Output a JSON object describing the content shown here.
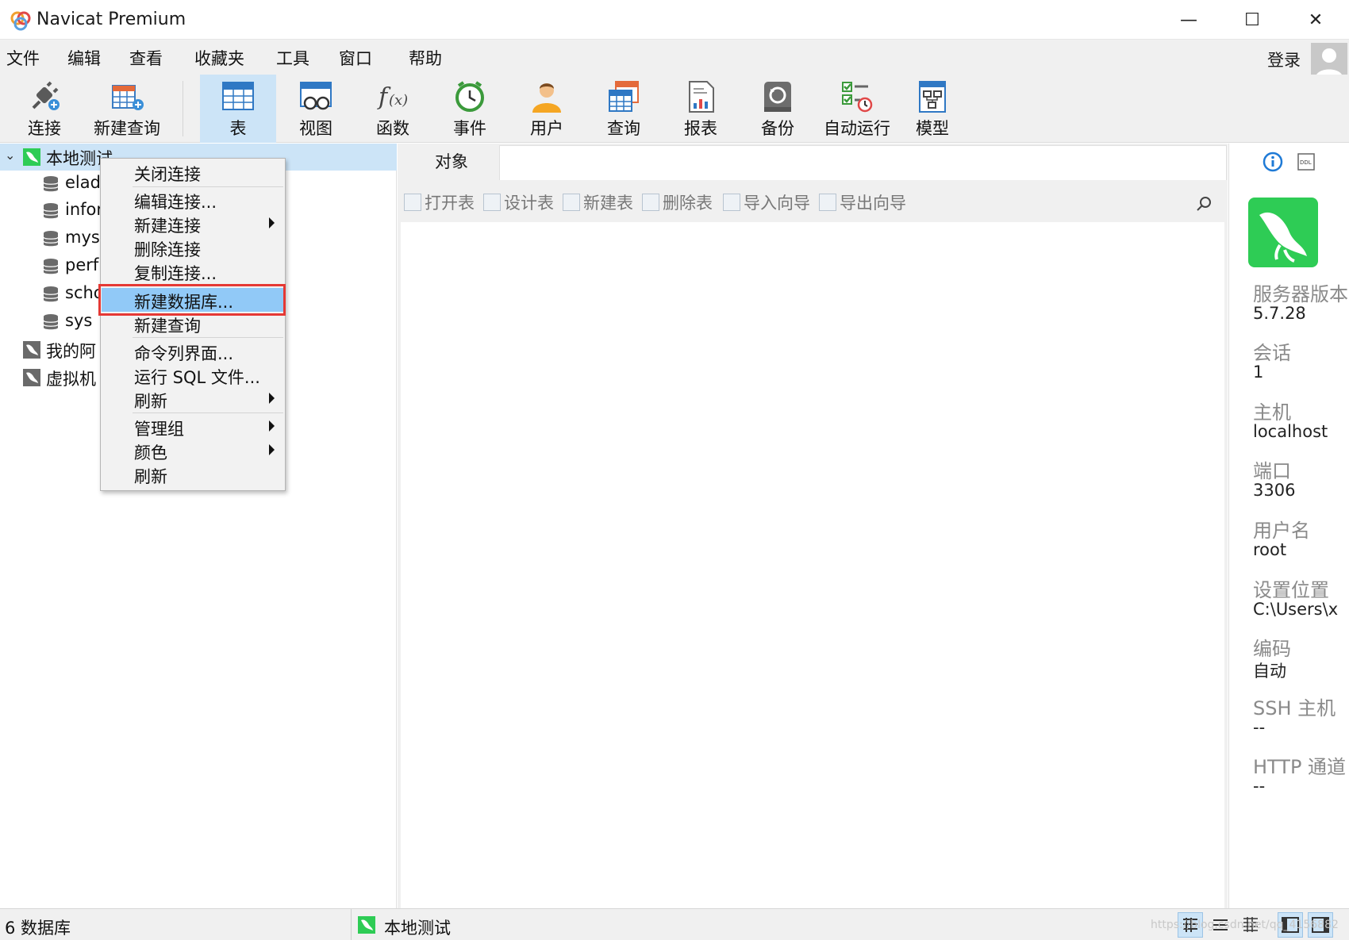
{
  "window": {
    "title": "Navicat Premium",
    "minimize_glyph": "—",
    "maximize_glyph": "☐",
    "close_glyph": "✕"
  },
  "menu": [
    "文件",
    "编辑",
    "查看",
    "收藏夹",
    "工具",
    "窗口",
    "帮助"
  ],
  "account": {
    "login_label": "登录"
  },
  "toolbar": [
    {
      "label": "连接",
      "icon": "plug-icon"
    },
    {
      "label": "新建查询",
      "icon": "new-query-icon"
    },
    {
      "label": "表",
      "icon": "table-icon",
      "active": true
    },
    {
      "label": "视图",
      "icon": "view-icon"
    },
    {
      "label": "函数",
      "icon": "function-icon"
    },
    {
      "label": "事件",
      "icon": "clock-icon"
    },
    {
      "label": "用户",
      "icon": "user-icon"
    },
    {
      "label": "查询",
      "icon": "query-icon"
    },
    {
      "label": "报表",
      "icon": "report-icon"
    },
    {
      "label": "备份",
      "icon": "backup-icon"
    },
    {
      "label": "自动运行",
      "icon": "automation-icon"
    },
    {
      "label": "模型",
      "icon": "model-icon"
    }
  ],
  "tree": {
    "connection": "本地测试",
    "databases": [
      "elad",
      "infor",
      "mys",
      "perf",
      "scho",
      "sys"
    ],
    "other_connections": [
      "我的阿",
      "虚拟机"
    ]
  },
  "context_menu": {
    "items": [
      {
        "label": "关闭连接"
      },
      {
        "label": "编辑连接..."
      },
      {
        "label": "新建连接",
        "submenu": true
      },
      {
        "label": "删除连接"
      },
      {
        "label": "复制连接..."
      },
      {
        "label": "新建数据库...",
        "highlighted": true
      },
      {
        "label": "新建查询"
      },
      {
        "label": "命令列界面..."
      },
      {
        "label": "运行 SQL 文件..."
      },
      {
        "label": "刷新",
        "submenu": true
      },
      {
        "label": "管理组",
        "submenu": true
      },
      {
        "label": "颜色",
        "submenu": true
      },
      {
        "label": "刷新"
      }
    ]
  },
  "objects": {
    "tab_label": "对象",
    "actions": [
      "打开表",
      "设计表",
      "新建表",
      "删除表",
      "导入向导",
      "导出向导"
    ]
  },
  "info_panel": {
    "fields": [
      {
        "label": "服务器版本",
        "value": "5.7.28"
      },
      {
        "label": "会话",
        "value": "1"
      },
      {
        "label": "主机",
        "value": "localhost"
      },
      {
        "label": "端口",
        "value": "3306"
      },
      {
        "label": "用户名",
        "value": "root"
      },
      {
        "label": "设置位置",
        "value": "C:\\Users\\x"
      },
      {
        "label": "编码",
        "value": "自动"
      },
      {
        "label": "SSH 主机",
        "value": "--"
      },
      {
        "label": "HTTP 通道",
        "value": "--"
      }
    ]
  },
  "status": {
    "db_count": "6 数据库",
    "connection": "本地测试",
    "watermark": "https://blog.csdn.net/qq_4156882"
  },
  "colors": {
    "selection": "#cce4f7",
    "menu_highlight": "#91c9f7",
    "highlight_box": "#e53935",
    "mysql_green": "#2ecc55"
  }
}
